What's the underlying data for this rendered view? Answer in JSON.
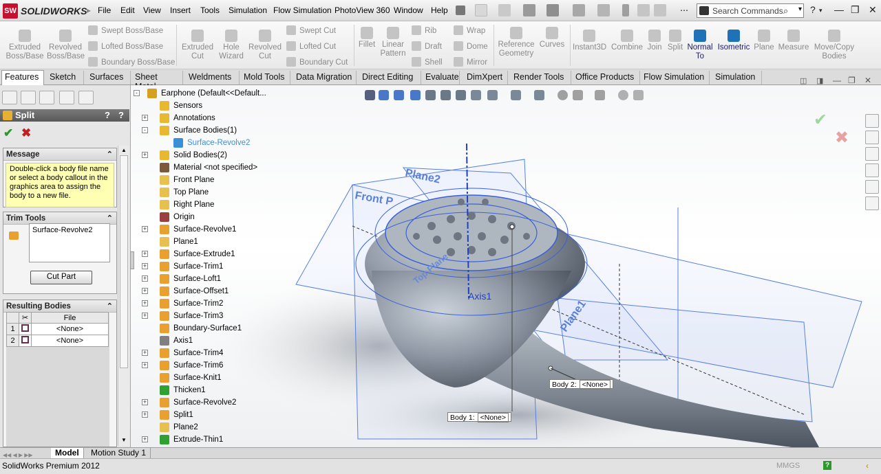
{
  "app": {
    "name": "SOLIDWORKS",
    "logo": "SW"
  },
  "menu": [
    "File",
    "Edit",
    "View",
    "Insert",
    "Tools",
    "Simulation",
    "Flow Simulation",
    "PhotoView 360",
    "Window",
    "Help"
  ],
  "search": {
    "placeholder": "Search Commands"
  },
  "command_manager": {
    "features": {
      "extruded_boss": "Extruded Boss/Base",
      "revolved_boss": "Revolved Boss/Base",
      "swept_boss": "Swept Boss/Base",
      "lofted_boss": "Lofted Boss/Base",
      "boundary_boss": "Boundary Boss/Base",
      "extruded_cut": "Extruded Cut",
      "hole_wizard": "Hole Wizard",
      "revolved_cut": "Revolved Cut",
      "swept_cut": "Swept Cut",
      "lofted_cut": "Lofted Cut",
      "boundary_cut": "Boundary Cut",
      "fillet": "Fillet",
      "linear_pattern": "Linear Pattern",
      "rib": "Rib",
      "draft": "Draft",
      "shell": "Shell",
      "wrap": "Wrap",
      "dome": "Dome",
      "mirror": "Mirror",
      "reference_geometry": "Reference Geometry",
      "curves": "Curves",
      "instant3d": "Instant3D",
      "combine": "Combine",
      "join": "Join",
      "split": "Split",
      "normal_to": "Normal To",
      "isometric": "Isometric",
      "plane": "Plane",
      "measure": "Measure",
      "move_copy_bodies": "Move/Copy Bodies"
    }
  },
  "tabs": [
    "Features",
    "Sketch",
    "Surfaces",
    "Sheet Metal",
    "Weldments",
    "Mold Tools",
    "Data Migration",
    "Direct Editing",
    "Evaluate",
    "DimXpert",
    "Render Tools",
    "Office Products",
    "Flow Simulation",
    "Simulation"
  ],
  "property_manager": {
    "title": "Split",
    "help": "?",
    "message": {
      "header": "Message",
      "text": "Double-click a body file name or select a body callout in the graphics area to assign the body to a new file."
    },
    "trim_tools": {
      "header": "Trim Tools",
      "item": "Surface-Revolve2",
      "button": "Cut Part"
    },
    "resulting_bodies": {
      "header": "Resulting Bodies",
      "col_file": "File",
      "rows": [
        {
          "num": "1",
          "file": "<None>"
        },
        {
          "num": "2",
          "file": "<None>"
        }
      ]
    }
  },
  "tree": [
    {
      "label": "Earphone  (Default<<Default...",
      "icon": "part-icon",
      "color": "#d8a020"
    },
    {
      "label": "Sensors",
      "icon": "sensors-folder-icon",
      "color": "#e8b830"
    },
    {
      "label": "Annotations",
      "icon": "annotations-icon",
      "color": "#e8b830"
    },
    {
      "label": "Surface Bodies(1)",
      "icon": "surface-bodies-folder-icon",
      "color": "#e8b830"
    },
    {
      "label": "Surface-Revolve2",
      "icon": "surface-body-icon",
      "color": "#3a90d8"
    },
    {
      "label": "Solid Bodies(2)",
      "icon": "solid-bodies-folder-icon",
      "color": "#e8b830"
    },
    {
      "label": "Material <not specified>",
      "icon": "material-icon",
      "color": "#7a5a3a"
    },
    {
      "label": "Front Plane",
      "icon": "plane-icon",
      "color": "#e8c050"
    },
    {
      "label": "Top Plane",
      "icon": "plane-icon",
      "color": "#e8c050"
    },
    {
      "label": "Right Plane",
      "icon": "plane-icon",
      "color": "#e8c050"
    },
    {
      "label": "Origin",
      "icon": "origin-icon",
      "color": "#9a4040"
    },
    {
      "label": "Surface-Revolve1",
      "icon": "surface-revolve-icon",
      "color": "#e8a030"
    },
    {
      "label": "Plane1",
      "icon": "plane-icon",
      "color": "#e8c050"
    },
    {
      "label": "Surface-Extrude1",
      "icon": "surface-extrude-icon",
      "color": "#e8a030"
    },
    {
      "label": "Surface-Trim1",
      "icon": "surface-trim-icon",
      "color": "#e8a030"
    },
    {
      "label": "Surface-Loft1",
      "icon": "surface-loft-icon",
      "color": "#e8a030"
    },
    {
      "label": "Surface-Offset1",
      "icon": "surface-offset-icon",
      "color": "#e8a030"
    },
    {
      "label": "Surface-Trim2",
      "icon": "surface-trim-icon",
      "color": "#e8a030"
    },
    {
      "label": "Surface-Trim3",
      "icon": "surface-trim-icon",
      "color": "#e8a030"
    },
    {
      "label": "Boundary-Surface1",
      "icon": "boundary-surface-icon",
      "color": "#e8a030"
    },
    {
      "label": "Axis1",
      "icon": "axis-icon",
      "color": "#808080"
    },
    {
      "label": "Surface-Trim4",
      "icon": "surface-trim-icon",
      "color": "#e8a030"
    },
    {
      "label": "Surface-Trim6",
      "icon": "surface-trim-icon",
      "color": "#e8a030"
    },
    {
      "label": "Surface-Knit1",
      "icon": "surface-knit-icon",
      "color": "#e8a030"
    },
    {
      "label": "Thicken1",
      "icon": "thicken-icon",
      "color": "#30a030"
    },
    {
      "label": "Surface-Revolve2",
      "icon": "surface-revolve-icon",
      "color": "#e8a030"
    },
    {
      "label": "Split1",
      "icon": "split-icon",
      "color": "#e8a030"
    },
    {
      "label": "Plane2",
      "icon": "plane-icon",
      "color": "#e8c050"
    },
    {
      "label": "Extrude-Thin1",
      "icon": "extrude-thin-icon",
      "color": "#30a030"
    }
  ],
  "graphics": {
    "labels": {
      "plane2": "Plane2",
      "front": "Front P",
      "plane1": "Plane1",
      "axis1": "Axis1",
      "top_plane": "Top Plane"
    },
    "callouts": [
      {
        "label": "Body  1:",
        "value": "<None>"
      },
      {
        "label": "Body  2:",
        "value": "<None>"
      }
    ]
  },
  "bottom_tabs": [
    "Model",
    "Motion Study 1"
  ],
  "status": {
    "text": "SolidWorks Premium 2012",
    "units": "MMGS",
    "help": "?"
  },
  "colors": {
    "accent_blue": "#1f72b8",
    "plane_blue": "#4a7ad8",
    "highlight_blue": "#3a90d8"
  }
}
